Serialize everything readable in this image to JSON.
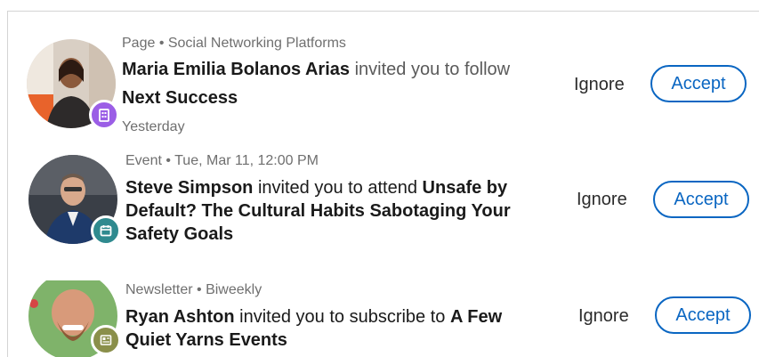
{
  "invitations": [
    {
      "meta": "Page • Social Networking Platforms",
      "sender": "Maria Emilia Bolanos Arias",
      "mid": " invited you to follow ",
      "target": "Next Success",
      "time": "Yesterday",
      "badge_icon": "building-icon",
      "badge_color": "#9b5ee6"
    },
    {
      "meta": "Event • Tue, Mar 11, 12:00 PM",
      "sender": "Steve Simpson",
      "mid": " invited you to attend ",
      "target": "Unsafe by Default?  The Cultural Habits Sabotaging Your Safety Goals",
      "badge_icon": "calendar-icon",
      "badge_color": "#2f8a8f"
    },
    {
      "meta": "Newsletter • Biweekly",
      "sender": "Ryan Ashton",
      "mid": " invited you to subscribe to ",
      "target": "A Few Quiet Yarns Events",
      "badge_icon": "newsletter-icon",
      "badge_color": "#8a8f4a"
    }
  ],
  "actions": {
    "ignore_label": "Ignore",
    "accept_label": "Accept"
  },
  "colors": {
    "accent": "#0a66c2"
  }
}
